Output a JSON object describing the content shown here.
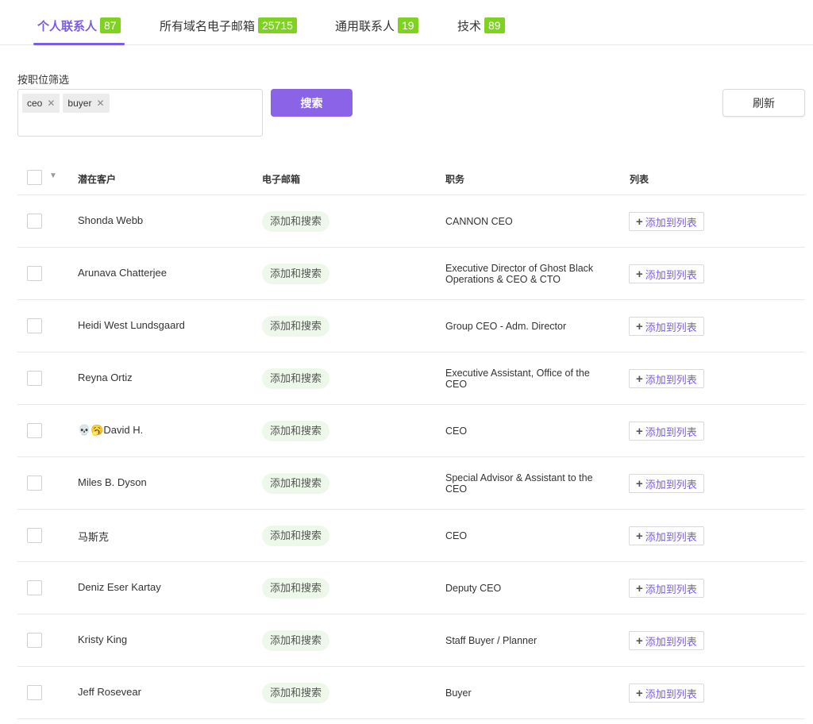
{
  "tabs": [
    {
      "label": "个人联系人",
      "count": "87"
    },
    {
      "label": "所有域名电子邮箱",
      "count": "25715"
    },
    {
      "label": "通用联系人",
      "count": "19"
    },
    {
      "label": "技术",
      "count": "89"
    }
  ],
  "filter": {
    "label": "按职位筛选",
    "tags": [
      "ceo",
      "buyer"
    ],
    "search_label": "搜索",
    "refresh_label": "刷新"
  },
  "table": {
    "headers": {
      "prospect": "潜在客户",
      "email": "电子邮箱",
      "title": "职务",
      "list": "列表"
    },
    "email_action": "添加和搜索",
    "add_to_list": "添加到列表",
    "rows": [
      {
        "name": "Shonda Webb",
        "title": "CANNON CEO"
      },
      {
        "name": "Arunava Chatterjee",
        "title": "Executive Director of Ghost Black Operations & CEO & CTO"
      },
      {
        "name": "Heidi West Lundsgaard",
        "title": "Group CEO - Adm. Director"
      },
      {
        "name": "Reyna Ortiz",
        "title": "Executive Assistant, Office of the CEO"
      },
      {
        "name": "💀🥱David H.",
        "title": "CEO"
      },
      {
        "name": "Miles B. Dyson",
        "title": "Special Advisor & Assistant to the CEO"
      },
      {
        "name": "马斯克",
        "title": "CEO"
      },
      {
        "name": "Deniz Eser Kartay",
        "title": "Deputy CEO"
      },
      {
        "name": "Kristy King",
        "title": "Staff Buyer / Planner"
      },
      {
        "name": "Jeff Rosevear",
        "title": "Buyer"
      }
    ]
  },
  "colors": {
    "accent": "#7b5ce6",
    "badge": "#7ed321",
    "email_pill_bg": "#eef8ea"
  }
}
